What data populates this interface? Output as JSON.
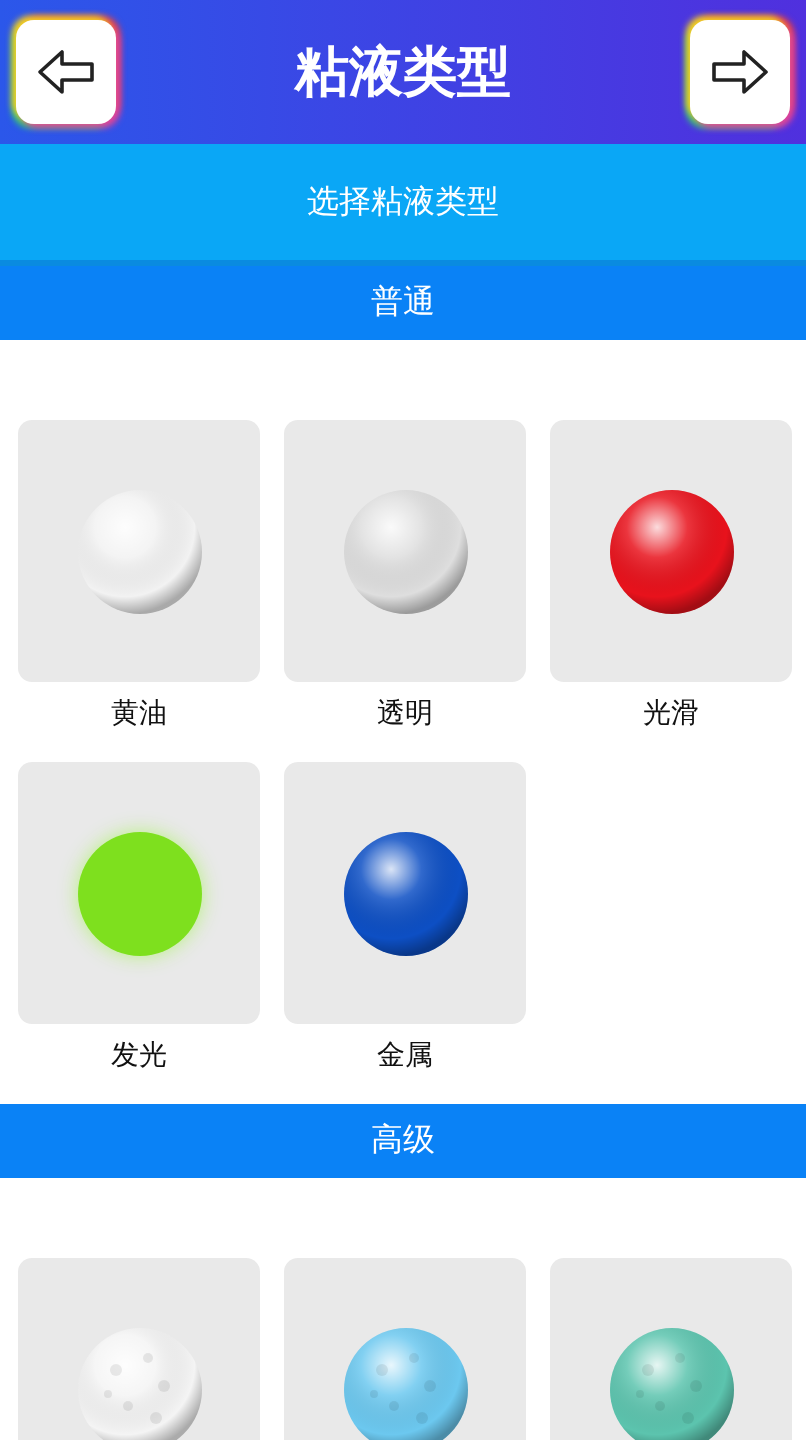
{
  "header": {
    "title": "粘液类型"
  },
  "subtitle": "选择粘液类型",
  "sections": [
    {
      "title": "普通",
      "items": [
        {
          "label": "黄油",
          "kind": "glossy",
          "color": "#f2f2f2"
        },
        {
          "label": "透明",
          "kind": "glossy",
          "color": "#dedede"
        },
        {
          "label": "光滑",
          "kind": "glossy",
          "color": "#e8121c"
        },
        {
          "label": "发光",
          "kind": "glow",
          "color": "#7ee01e"
        },
        {
          "label": "金属",
          "kind": "glossy",
          "color": "#0d4fc4"
        }
      ]
    },
    {
      "title": "高级",
      "items": [
        {
          "kind": "textured",
          "color": "#f4f4f4"
        },
        {
          "kind": "textured",
          "color": "#6cc8ef"
        },
        {
          "kind": "textured",
          "color": "#5cc4ae"
        }
      ]
    }
  ]
}
